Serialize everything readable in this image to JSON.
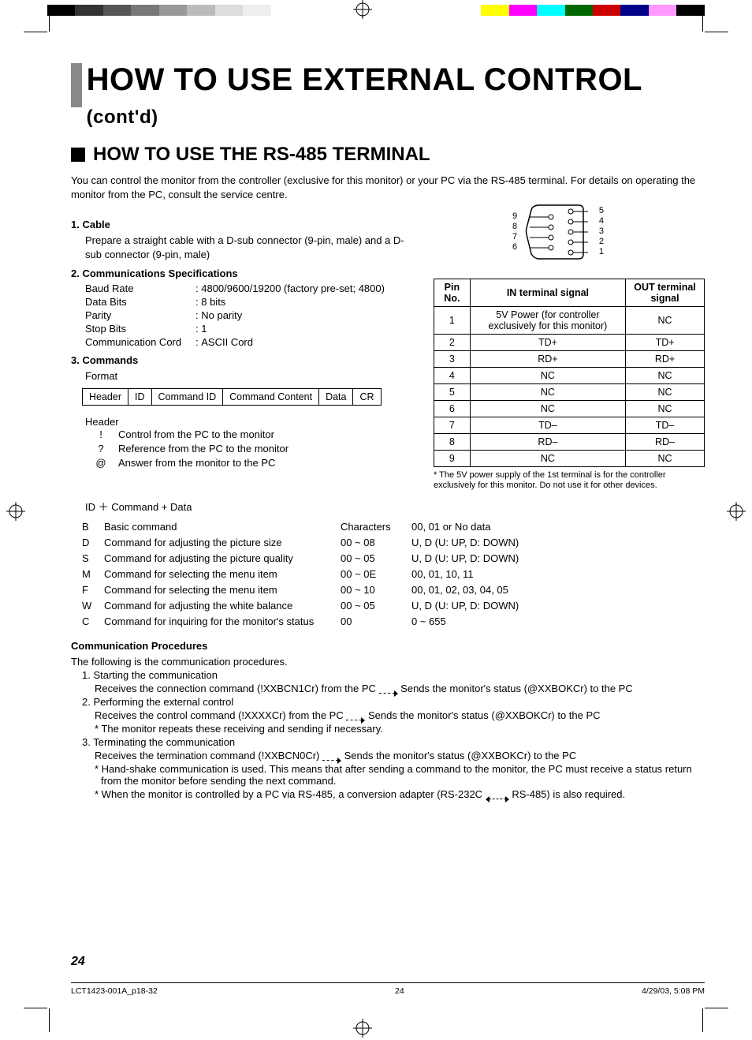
{
  "title_main": "HOW TO USE EXTERNAL CONTROL ",
  "title_cont": "(cont'd)",
  "subtitle": "HOW TO USE THE RS-485 TERMINAL",
  "intro": "You can control the monitor from the controller (exclusive for this monitor) or your PC via the RS-485 terminal.  For details on operating the monitor from the PC, consult the service centre.",
  "sec1_head": "1. Cable",
  "sec1_body": "Prepare a straight cable with a D-sub connector (9-pin, male) and a D-sub connector (9-pin, male)",
  "sec2_head": "2. Communications Specifications",
  "specs": [
    {
      "k": "Baud Rate",
      "v": "4800/9600/19200 (factory pre-set; 4800)"
    },
    {
      "k": "Data Bits",
      "v": "8 bits"
    },
    {
      "k": "Parity",
      "v": "No parity"
    },
    {
      "k": "Stop Bits",
      "v": "1"
    },
    {
      "k": "Communication Cord",
      "v": "ASCII Cord"
    }
  ],
  "sec3_head": "3. Commands",
  "sec3_format": "Format",
  "format_cells": [
    "Header",
    "ID",
    "Command ID",
    "Command Content",
    "Data",
    "CR"
  ],
  "sec3_header_label": "Header",
  "header_lines": [
    {
      "sym": "!",
      "txt": "Control from the PC to the monitor"
    },
    {
      "sym": "?",
      "txt": "Reference from the PC to the monitor"
    },
    {
      "sym": "@",
      "txt": "Answer from the monitor to the PC"
    }
  ],
  "idcmd_label": "ID ＋ Command + Data",
  "cmd_rows": [
    {
      "c0": "B",
      "c1": "Basic command",
      "c2": "Characters",
      "c3": "00, 01 or No data"
    },
    {
      "c0": "D",
      "c1": "Command for adjusting the picture size",
      "c2": "00 ~ 08",
      "c3": "U, D (U: UP, D: DOWN)"
    },
    {
      "c0": "S",
      "c1": "Command for adjusting the picture quality",
      "c2": "00 ~ 05",
      "c3": "U, D (U: UP, D: DOWN)"
    },
    {
      "c0": "M",
      "c1": "Command for selecting the menu item",
      "c2": "00 ~ 0E",
      "c3": "00, 01, 10, 11"
    },
    {
      "c0": "F",
      "c1": "Command for selecting the menu item",
      "c2": "00 ~ 10",
      "c3": "00, 01, 02, 03, 04, 05"
    },
    {
      "c0": "W",
      "c1": "Command for adjusting the white balance",
      "c2": "00 ~ 05",
      "c3": "U, D (U: UP, D: DOWN)"
    },
    {
      "c0": "C",
      "c1": "Command for inquiring for the monitor's status",
      "c2": "00",
      "c3": "0 ~ 655"
    }
  ],
  "pin_headers": [
    "Pin No.",
    "IN terminal signal",
    "OUT terminal signal"
  ],
  "pin_rows": [
    [
      "1",
      "5V Power (for controller exclusively for this monitor)",
      "NC"
    ],
    [
      "2",
      "TD+",
      "TD+"
    ],
    [
      "3",
      "RD+",
      "RD+"
    ],
    [
      "4",
      "NC",
      "NC"
    ],
    [
      "5",
      "NC",
      "NC"
    ],
    [
      "6",
      "NC",
      "NC"
    ],
    [
      "7",
      "TD–",
      "TD–"
    ],
    [
      "8",
      "RD–",
      "RD–"
    ],
    [
      "9",
      "NC",
      "NC"
    ]
  ],
  "pin_note": "* The 5V power supply of the 1st terminal is for the controller exclusively for this monitor.  Do not use it for other devices.",
  "conn_nums_left": [
    "9",
    "8",
    "7",
    "6"
  ],
  "conn_nums_right": [
    "5",
    "4",
    "3",
    "2",
    "1"
  ],
  "proc_head": "Communication Procedures",
  "proc_intro": "The following is the communication procedures.",
  "proc_steps": [
    {
      "n": "1.",
      "t": "Starting the communication",
      "lines": [
        {
          "a": "Receives the connection command (!XXBCN1Cr) from the PC",
          "b": "Sends the monitor's status (@XXBOKCr) to the PC"
        }
      ]
    },
    {
      "n": "2.",
      "t": "Performing the external control",
      "lines": [
        {
          "a": "Receives the control command (!XXXXCr) from the PC",
          "b": "Sends the monitor's status (@XXBOKCr) to the PC"
        },
        {
          "plain": "* The monitor repeats these receiving and sending if necessary."
        }
      ]
    },
    {
      "n": "3.",
      "t": "Terminating the communication",
      "lines": [
        {
          "a": "Receives the termination command (!XXBCN0Cr)",
          "b": "Sends the monitor's status (@XXBOKCr) to the PC"
        },
        {
          "plain": "* Hand-shake communication is used. This means that after sending a command to the monitor, the PC must receive a status return from the monitor before sending the next command."
        },
        {
          "plain2a": "* When the monitor is controlled by a PC via RS-485, a conversion adapter (RS-232C",
          "plain2b": "RS-485) is also required."
        }
      ]
    }
  ],
  "page_number": "24",
  "footer_left": "LCT1423-001A_p18-32",
  "footer_mid": "24",
  "footer_right": "4/29/03, 5:08 PM"
}
